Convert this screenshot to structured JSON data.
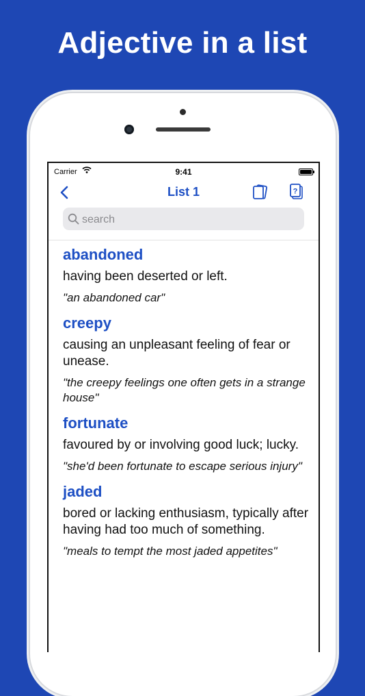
{
  "headline": "Adjective in a list",
  "status_bar": {
    "carrier": "Carrier",
    "time": "9:41"
  },
  "nav": {
    "title": "List 1",
    "back_icon": "chevron-left-icon",
    "cards_icon": "flashcards-icon",
    "quiz_icon": "quiz-question-icon"
  },
  "search": {
    "placeholder": "search",
    "value": ""
  },
  "colors": {
    "background": "#1e47b4",
    "accent": "#1d4fc4"
  },
  "entries": [
    {
      "word": "abandoned",
      "definition": "having been deserted or left.",
      "example": "\"an abandoned car\""
    },
    {
      "word": "creepy",
      "definition": "causing an unpleasant feeling of fear or unease.",
      "example": "\"the creepy feelings one often gets in a strange house\""
    },
    {
      "word": "fortunate",
      "definition": "favoured by or involving good luck; lucky.",
      "example": "\"she'd been fortunate to escape serious injury\""
    },
    {
      "word": "jaded",
      "definition": "bored or lacking enthusiasm, typically after having had too much of something.",
      "example": "\"meals to tempt the most jaded appetites\""
    }
  ]
}
